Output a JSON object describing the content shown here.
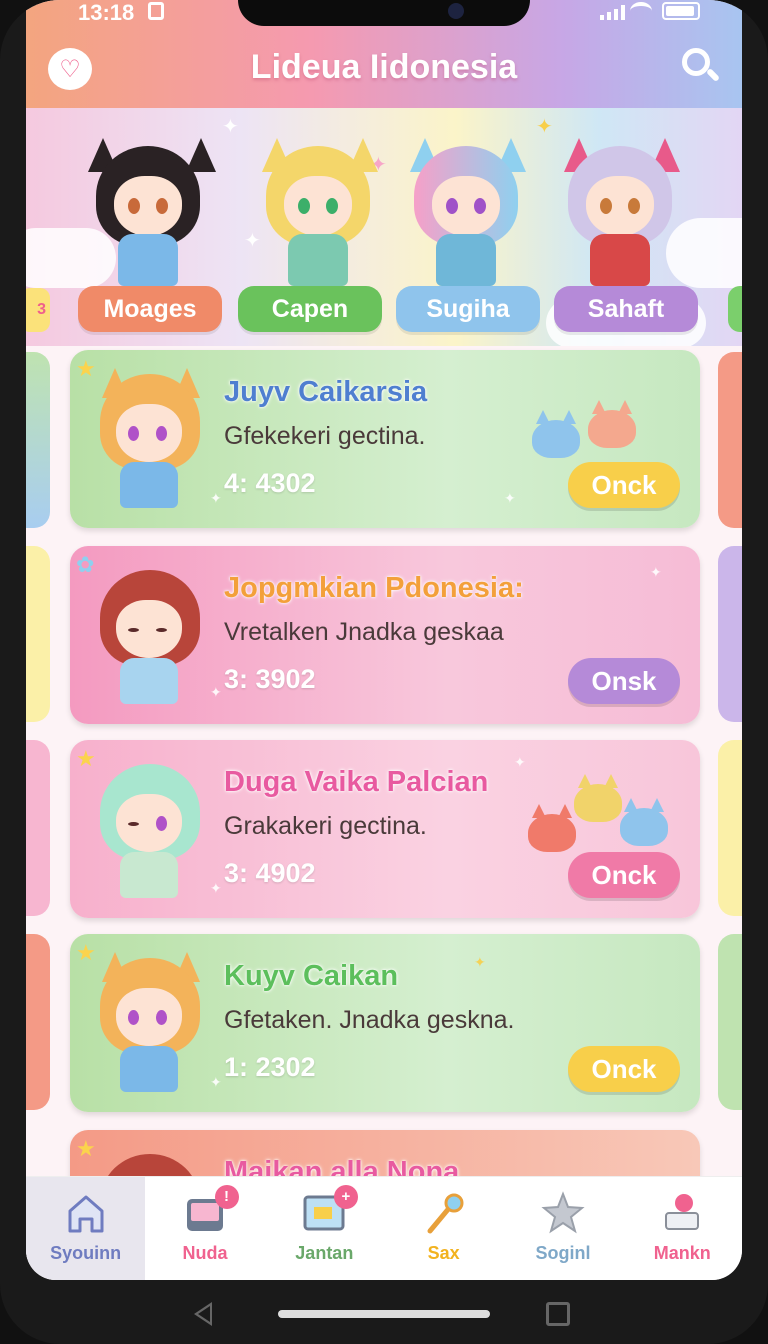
{
  "status": {
    "time": "13:18"
  },
  "header": {
    "title": "Lideua Iidonesia"
  },
  "banner": {
    "chips": [
      {
        "label": "Moages",
        "color": "#f08a68"
      },
      {
        "label": "Capen",
        "color": "#6ac25c"
      },
      {
        "label": "Sugiha",
        "color": "#8fc4ec"
      },
      {
        "label": "Sahaft",
        "color": "#b58ad8"
      }
    ],
    "edge_badge": "3"
  },
  "cards": [
    {
      "name": "Juyv Caikarsia",
      "desc": "Gfekekeri gectina.",
      "stat": "4: 4302",
      "button": "Onck"
    },
    {
      "name": "Jopgmkian Pdonesia:",
      "desc": "Vretalken Jnadka geskaa",
      "stat": "3: 3902",
      "button": "Onsk"
    },
    {
      "name": "Duga Vaika Palcian",
      "desc": "Grakakeri gectina.",
      "stat": "3: 4902",
      "button": "Onck"
    },
    {
      "name": "Kuyv Caikan",
      "desc": "Gfetaken. Jnadka geskna.",
      "stat": "1: 2302",
      "button": "Onck"
    },
    {
      "name": "Maikan alla Nona",
      "desc": "",
      "stat": "",
      "button": ""
    }
  ],
  "nav": [
    {
      "label": "Syouinn",
      "icon": "home-icon",
      "badge": ""
    },
    {
      "label": "Nuda",
      "icon": "tablet-icon",
      "badge": "!"
    },
    {
      "label": "Jantan",
      "icon": "board-icon",
      "badge": "+"
    },
    {
      "label": "Sax",
      "icon": "magic-wand-icon",
      "badge": ""
    },
    {
      "label": "Soginl",
      "icon": "star-icon",
      "badge": ""
    },
    {
      "label": "Mankn",
      "icon": "gift-icon",
      "badge": ""
    }
  ],
  "colors": {
    "accent": "#ef5f8c",
    "green_card": "#bfe3b0",
    "pink_card": "#f7b6d0",
    "yellow_button": "#f8cf4a",
    "purple_button": "#b58ad8",
    "pink_button": "#f07aa7"
  }
}
